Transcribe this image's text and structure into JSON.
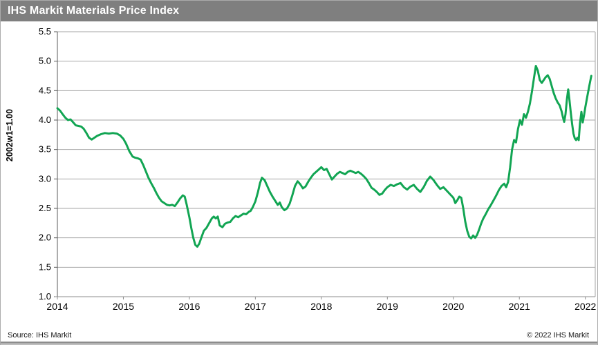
{
  "window": {
    "title": "IHS Markit Materials Price Index"
  },
  "footer": {
    "source": "Source:  IHS Markit",
    "copyright": "© 2022  IHS Markit"
  },
  "colors": {
    "title_bar_bg": "#7f7f7f",
    "title_text": "#ffffff",
    "line": "#12a553",
    "gridline": "#a6a6a6",
    "y_axis": "#595959",
    "x_axis": "#8c8c8c",
    "tick_label": "#000000",
    "footer_bar": "#8c8c8c"
  },
  "chart_data": {
    "type": "line",
    "title": "IHS Markit Materials Price Index",
    "xlabel": "",
    "ylabel": "2002w1=1.00",
    "xlim": [
      2014,
      2022.15
    ],
    "ylim": [
      1.0,
      5.5
    ],
    "xticks": [
      2014,
      2015,
      2016,
      2017,
      2018,
      2019,
      2020,
      2021,
      2022
    ],
    "xtick_labels": [
      "2014",
      "2015",
      "2016",
      "2017",
      "2018",
      "2019",
      "2020",
      "2021",
      "2022"
    ],
    "yticks": [
      5.5,
      5.0,
      4.5,
      4.0,
      3.5,
      3.0,
      2.5,
      2.0,
      1.5,
      1.0
    ],
    "ytick_labels": [
      "5.5",
      "5.0",
      "4.5",
      "4.0",
      "3.5",
      "3.0",
      "2.5",
      "2.0",
      "1.5",
      "1.0"
    ],
    "grid": "horizontal",
    "legend": "none",
    "series": [
      {
        "name": "Materials Price Index (2002w1=1.00)",
        "x": [
          2014.0,
          2014.04,
          2014.08,
          2014.12,
          2014.16,
          2014.2,
          2014.24,
          2014.28,
          2014.32,
          2014.36,
          2014.4,
          2014.44,
          2014.48,
          2014.52,
          2014.56,
          2014.6,
          2014.66,
          2014.72,
          2014.78,
          2014.84,
          2014.9,
          2014.95,
          2015.0,
          2015.04,
          2015.09,
          2015.14,
          2015.18,
          2015.22,
          2015.26,
          2015.3,
          2015.34,
          2015.38,
          2015.42,
          2015.46,
          2015.5,
          2015.54,
          2015.58,
          2015.62,
          2015.66,
          2015.7,
          2015.74,
          2015.78,
          2015.82,
          2015.86,
          2015.9,
          2015.93,
          2015.96,
          2016.0,
          2016.03,
          2016.06,
          2016.09,
          2016.12,
          2016.15,
          2016.18,
          2016.22,
          2016.26,
          2016.3,
          2016.34,
          2016.37,
          2016.4,
          2016.43,
          2016.46,
          2016.5,
          2016.54,
          2016.58,
          2016.62,
          2016.66,
          2016.7,
          2016.74,
          2016.78,
          2016.82,
          2016.86,
          2016.9,
          2016.93,
          2016.96,
          2017.0,
          2017.04,
          2017.07,
          2017.1,
          2017.14,
          2017.18,
          2017.22,
          2017.26,
          2017.3,
          2017.34,
          2017.37,
          2017.4,
          2017.44,
          2017.48,
          2017.52,
          2017.56,
          2017.6,
          2017.64,
          2017.68,
          2017.72,
          2017.76,
          2017.8,
          2017.84,
          2017.88,
          2017.92,
          2017.96,
          2018.0,
          2018.04,
          2018.08,
          2018.12,
          2018.16,
          2018.2,
          2018.24,
          2018.28,
          2018.32,
          2018.36,
          2018.4,
          2018.44,
          2018.48,
          2018.52,
          2018.56,
          2018.6,
          2018.64,
          2018.68,
          2018.72,
          2018.76,
          2018.8,
          2018.84,
          2018.88,
          2018.92,
          2018.96,
          2019.0,
          2019.05,
          2019.1,
          2019.15,
          2019.2,
          2019.25,
          2019.3,
          2019.35,
          2019.4,
          2019.45,
          2019.5,
          2019.55,
          2019.6,
          2019.65,
          2019.7,
          2019.75,
          2019.8,
          2019.85,
          2019.9,
          2019.95,
          2020.0,
          2020.03,
          2020.06,
          2020.09,
          2020.12,
          2020.15,
          2020.18,
          2020.21,
          2020.24,
          2020.27,
          2020.3,
          2020.33,
          2020.36,
          2020.39,
          2020.42,
          2020.45,
          2020.49,
          2020.53,
          2020.57,
          2020.61,
          2020.65,
          2020.69,
          2020.73,
          2020.77,
          2020.8,
          2020.83,
          2020.86,
          2020.89,
          2020.92,
          2020.95,
          2020.98,
          2021.01,
          2021.04,
          2021.07,
          2021.1,
          2021.13,
          2021.16,
          2021.19,
          2021.22,
          2021.25,
          2021.28,
          2021.31,
          2021.34,
          2021.37,
          2021.4,
          2021.43,
          2021.46,
          2021.49,
          2021.52,
          2021.55,
          2021.58,
          2021.61,
          2021.64,
          2021.66,
          2021.68,
          2021.7,
          2021.72,
          2021.74,
          2021.76,
          2021.78,
          2021.8,
          2021.82,
          2021.84,
          2021.86,
          2021.88,
          2021.9,
          2021.92,
          2021.94,
          2021.96,
          2021.98,
          2022.0,
          2022.03,
          2022.06,
          2022.09
        ],
        "y": [
          4.2,
          4.16,
          4.1,
          4.04,
          4.0,
          4.01,
          3.96,
          3.91,
          3.9,
          3.89,
          3.85,
          3.78,
          3.7,
          3.67,
          3.7,
          3.73,
          3.76,
          3.78,
          3.77,
          3.78,
          3.77,
          3.74,
          3.68,
          3.6,
          3.47,
          3.38,
          3.36,
          3.35,
          3.33,
          3.24,
          3.13,
          3.02,
          2.93,
          2.85,
          2.76,
          2.68,
          2.62,
          2.59,
          2.56,
          2.55,
          2.56,
          2.54,
          2.6,
          2.67,
          2.72,
          2.7,
          2.56,
          2.35,
          2.16,
          2.0,
          1.88,
          1.85,
          1.9,
          2.0,
          2.12,
          2.17,
          2.25,
          2.33,
          2.36,
          2.33,
          2.36,
          2.21,
          2.18,
          2.24,
          2.26,
          2.27,
          2.33,
          2.37,
          2.35,
          2.38,
          2.41,
          2.4,
          2.44,
          2.46,
          2.52,
          2.62,
          2.78,
          2.93,
          3.02,
          2.98,
          2.88,
          2.78,
          2.7,
          2.63,
          2.56,
          2.6,
          2.52,
          2.47,
          2.5,
          2.58,
          2.72,
          2.88,
          2.96,
          2.91,
          2.84,
          2.87,
          2.95,
          3.02,
          3.08,
          3.12,
          3.16,
          3.2,
          3.15,
          3.17,
          3.08,
          2.99,
          3.04,
          3.09,
          3.12,
          3.1,
          3.08,
          3.12,
          3.14,
          3.12,
          3.1,
          3.12,
          3.09,
          3.05,
          3.0,
          2.93,
          2.85,
          2.82,
          2.78,
          2.73,
          2.75,
          2.81,
          2.86,
          2.9,
          2.88,
          2.91,
          2.93,
          2.86,
          2.82,
          2.87,
          2.9,
          2.83,
          2.78,
          2.86,
          2.97,
          3.04,
          2.98,
          2.9,
          2.83,
          2.86,
          2.8,
          2.74,
          2.68,
          2.59,
          2.64,
          2.7,
          2.68,
          2.5,
          2.28,
          2.12,
          2.02,
          1.99,
          2.04,
          2.0,
          2.05,
          2.14,
          2.24,
          2.32,
          2.4,
          2.49,
          2.56,
          2.64,
          2.72,
          2.81,
          2.88,
          2.92,
          2.86,
          2.95,
          3.2,
          3.5,
          3.66,
          3.62,
          3.85,
          4.0,
          3.92,
          4.1,
          4.04,
          4.14,
          4.28,
          4.48,
          4.7,
          4.92,
          4.84,
          4.68,
          4.63,
          4.68,
          4.73,
          4.76,
          4.7,
          4.58,
          4.46,
          4.37,
          4.3,
          4.25,
          4.15,
          4.05,
          3.97,
          4.1,
          4.35,
          4.52,
          4.33,
          4.12,
          3.93,
          3.77,
          3.69,
          3.66,
          3.7,
          3.66,
          3.95,
          4.14,
          3.96,
          4.08,
          4.22,
          4.4,
          4.58,
          4.75
        ]
      }
    ]
  }
}
